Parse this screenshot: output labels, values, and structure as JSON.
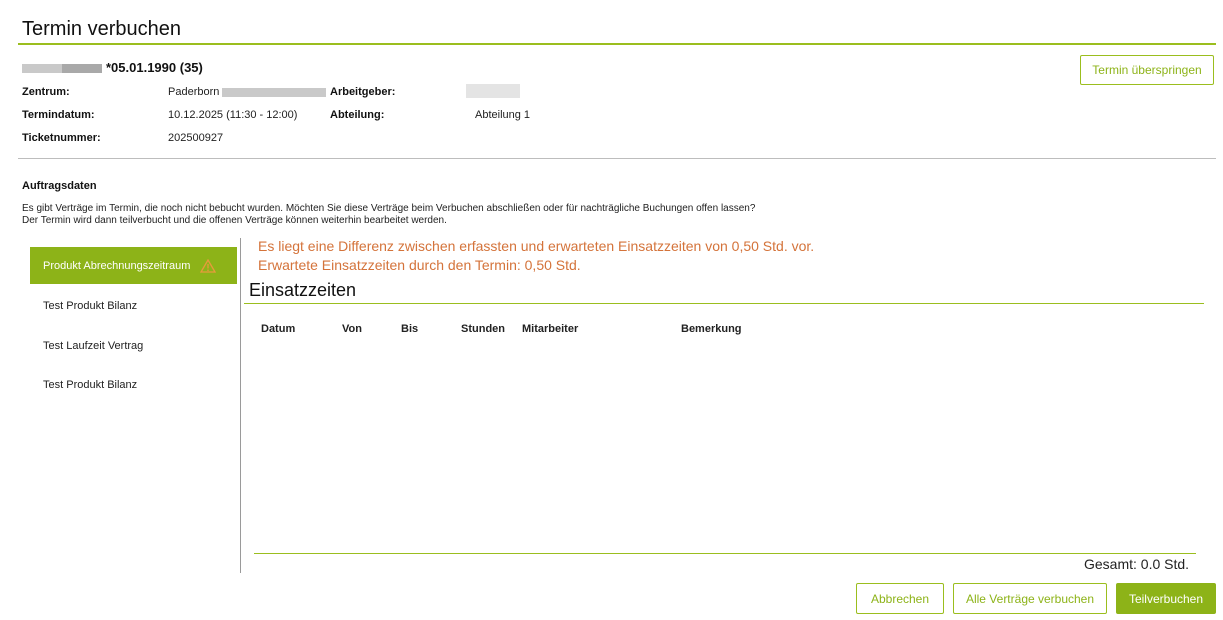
{
  "header": {
    "title": "Termin verbuchen",
    "skip_button": "Termin überspringen"
  },
  "patient": {
    "dob": "*05.01.1990 (35)",
    "zentrum_label": "Zentrum:",
    "zentrum_value": "Paderborn",
    "arbeitgeber_label": "Arbeitgeber:",
    "termindatum_label": "Termindatum:",
    "termindatum_value": "10.12.2025 (11:30 - 12:00)",
    "abteilung_label": "Abteilung:",
    "abteilung_value": "Abteilung 1",
    "ticket_label": "Ticketnummer:",
    "ticket_value": "202500927"
  },
  "auftrag": {
    "title": "Auftragsdaten",
    "info_line1": "Es gibt Verträge im Termin, die noch nicht bebucht wurden. Möchten Sie diese Verträge beim Verbuchen abschließen oder für nachträgliche Buchungen offen lassen?",
    "info_line2": "Der Termin wird dann teilverbucht und die offenen Verträge können weiterhin bearbeitet werden."
  },
  "sidebar": {
    "items": [
      {
        "label": "Produkt Abrechnungszeitraum",
        "active": true
      },
      {
        "label": "Test Produkt Bilanz",
        "active": false
      },
      {
        "label": "Test Laufzeit Vertrag",
        "active": false
      },
      {
        "label": "Test Produkt Bilanz",
        "active": false
      }
    ]
  },
  "main": {
    "warning_line1": "Es liegt eine Differenz zwischen erfassten und erwarteten Einsatzzeiten von 0,50 Std. vor.",
    "warning_line2": "Erwartete Einsatzzeiten durch den Termin: 0,50 Std.",
    "section_title": "Einsatzzeiten",
    "columns": [
      "Datum",
      "Von",
      "Bis",
      "Stunden",
      "Mitarbeiter",
      "Bemerkung"
    ],
    "total": "Gesamt: 0.0 Std."
  },
  "footer": {
    "cancel": "Abbrechen",
    "book_all": "Alle Verträge verbuchen",
    "partial": "Teilverbuchen"
  },
  "colors": {
    "accent": "#8db318",
    "warning": "#d4733a"
  }
}
